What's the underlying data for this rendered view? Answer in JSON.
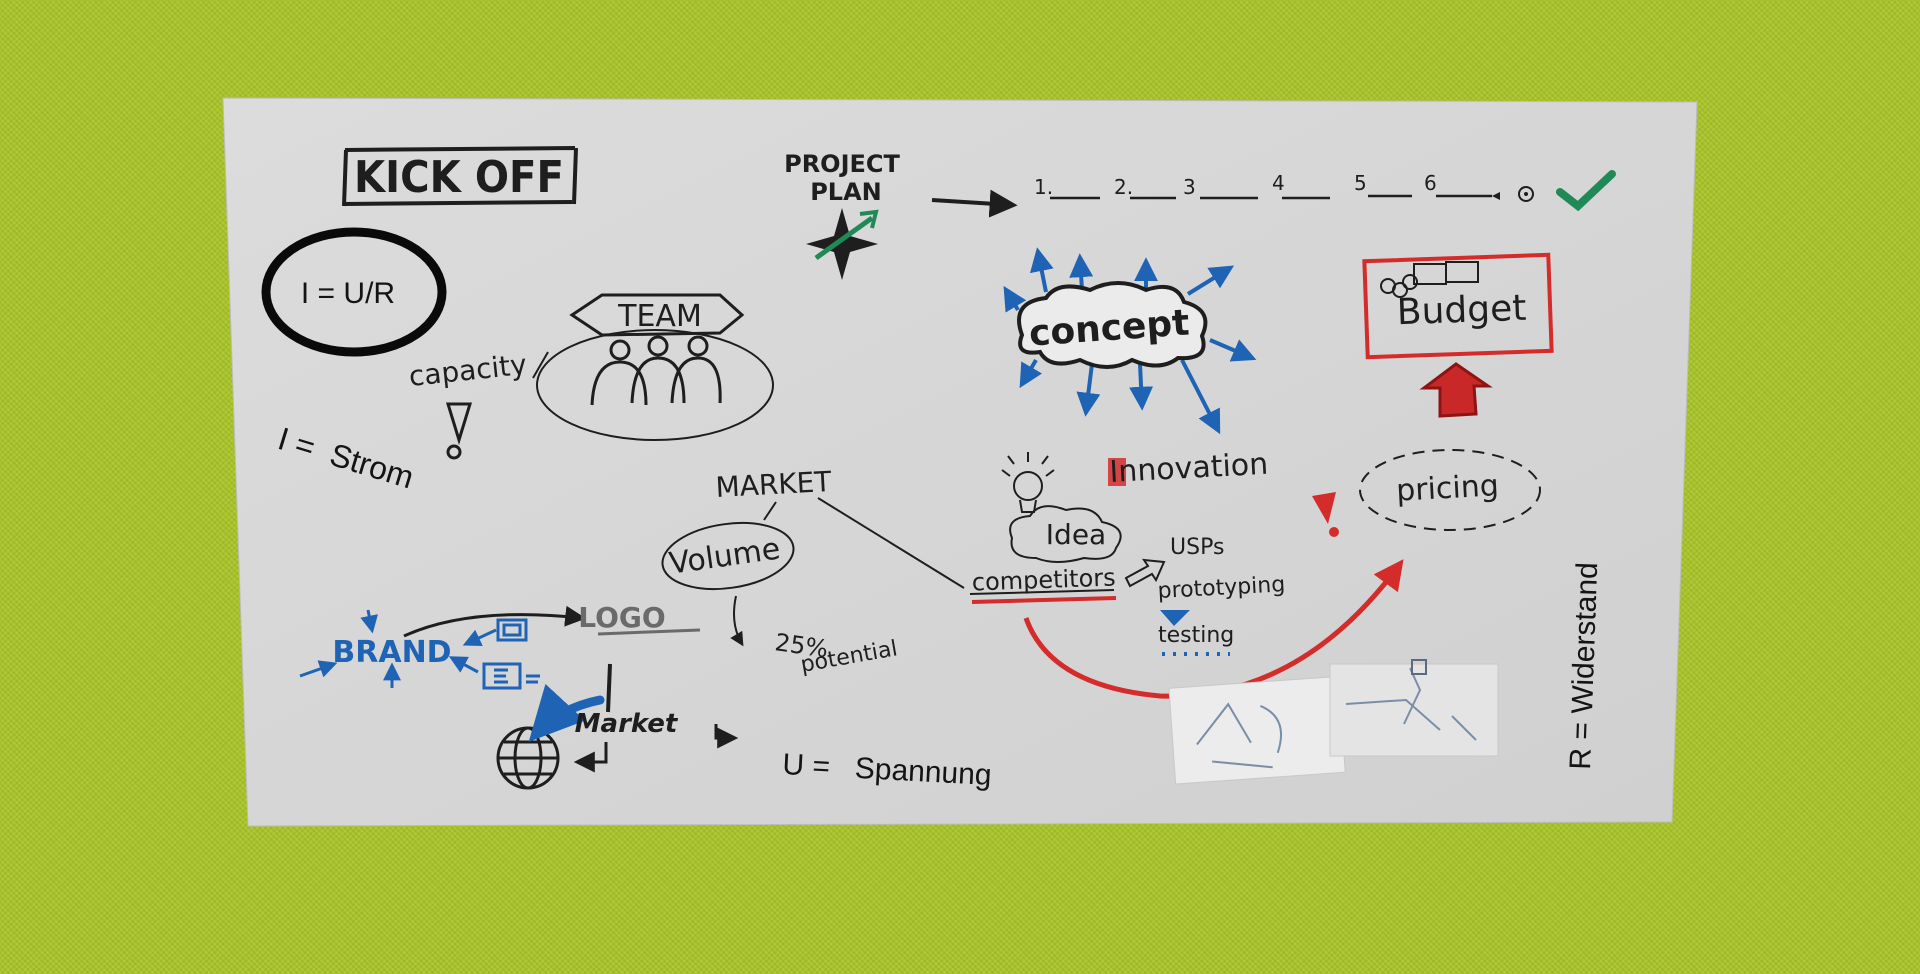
{
  "whiteboard": {
    "kickoff": "KICK OFF",
    "project_plan_line1": "PROJECT",
    "project_plan_line2": "PLAN",
    "timeline_steps": [
      "1.",
      "2.",
      "3",
      "4",
      "5",
      "6"
    ],
    "team": "TEAM",
    "capacity": "capacity",
    "concept": "concept",
    "budget": "Budget",
    "innovation": "Innovation",
    "pricing": "pricing",
    "market": "MARKET",
    "volume": "Volume",
    "idea": "Idea",
    "usps": "USPs",
    "prototyping": "prototyping",
    "testing": "testing",
    "competitors": "competitors",
    "logo": "LOGO",
    "brand": "BRAND",
    "potential_percent": "25%",
    "potential_label": "potential",
    "market_globe": "Market"
  },
  "overlay": {
    "formula": "I = U/R",
    "current": "I =  Strom",
    "voltage": "U =   Spannung",
    "resistance": "R = Widerstand"
  },
  "colors": {
    "background": "#a9c528",
    "board": "#d8d8d8",
    "ink": "#1e1e1e",
    "accent_blue": "#1f63b5",
    "accent_red": "#d42b2b",
    "accent_green": "#1f8a55"
  }
}
